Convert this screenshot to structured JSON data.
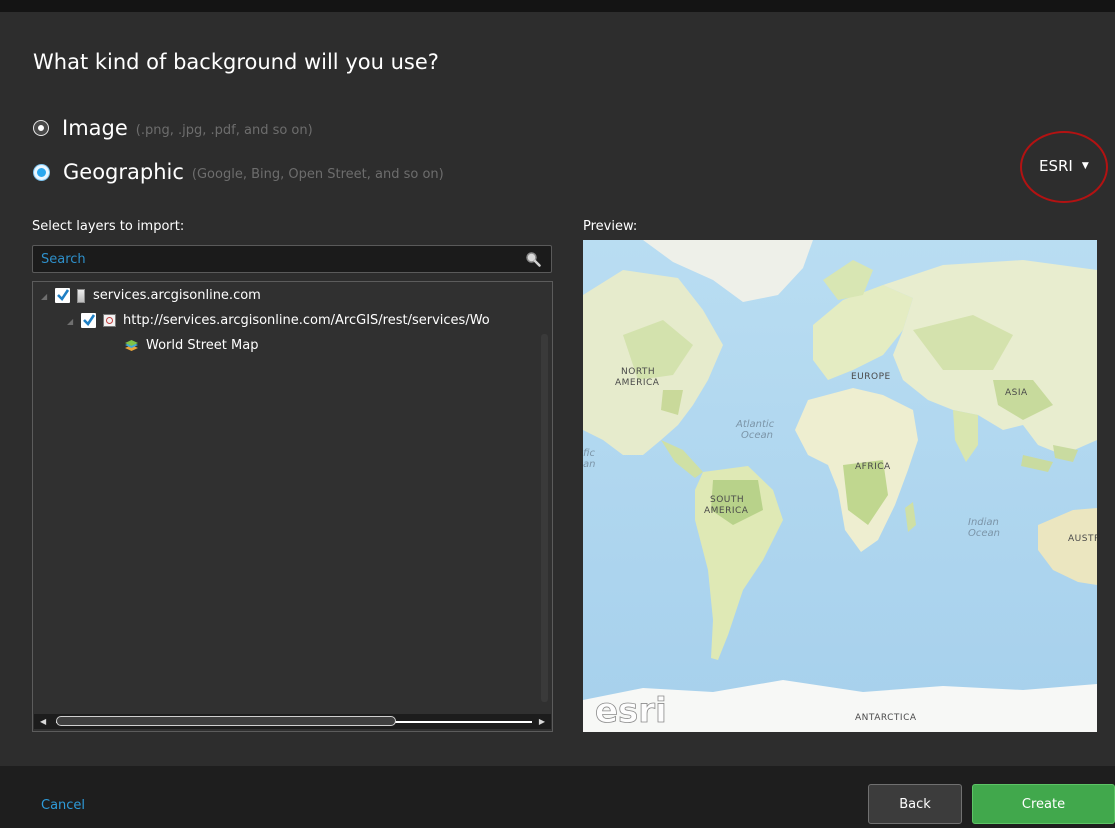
{
  "dialog": {
    "heading": "What kind of background will you use?"
  },
  "options": [
    {
      "label": "Image",
      "hint": "(.png, .jpg, .pdf, and so on)",
      "selected": false
    },
    {
      "label": "Geographic",
      "hint": "(Google, Bing, Open Street, and so on)",
      "selected": true
    }
  ],
  "provider": {
    "value": "ESRI"
  },
  "layers": {
    "label": "Select layers to import:",
    "search_placeholder": "Search",
    "tree": [
      {
        "text": "services.arcgisonline.com",
        "checked": true,
        "icon": "server-icon"
      },
      {
        "text": "http://services.arcgisonline.com/ArcGIS/rest/services/Wo",
        "checked": true,
        "icon": "map-service-icon"
      },
      {
        "text": "World Street Map",
        "icon": "layer-icon"
      }
    ]
  },
  "preview": {
    "label": "Preview:",
    "map_labels": {
      "north_america": "NORTH\nAMERICA",
      "europe": "EUROPE",
      "asia": "ASIA",
      "atlantic": "Atlantic\nOcean",
      "pacific_partial": "fic\nan",
      "africa": "AFRICA",
      "south_america": "SOUTH\nAMERICA",
      "indian": "Indian\nOcean",
      "australia_partial": "AUSTR",
      "antarctica": "ANTARCTICA"
    },
    "watermark": "esri"
  },
  "footer": {
    "cancel_label": "Cancel",
    "back_label": "Back",
    "create_label": "Create"
  },
  "colors": {
    "background": "#2d2d2d",
    "accent": "#2e9bd9",
    "create": "#41a84c",
    "highlight_circle": "#b31212"
  }
}
